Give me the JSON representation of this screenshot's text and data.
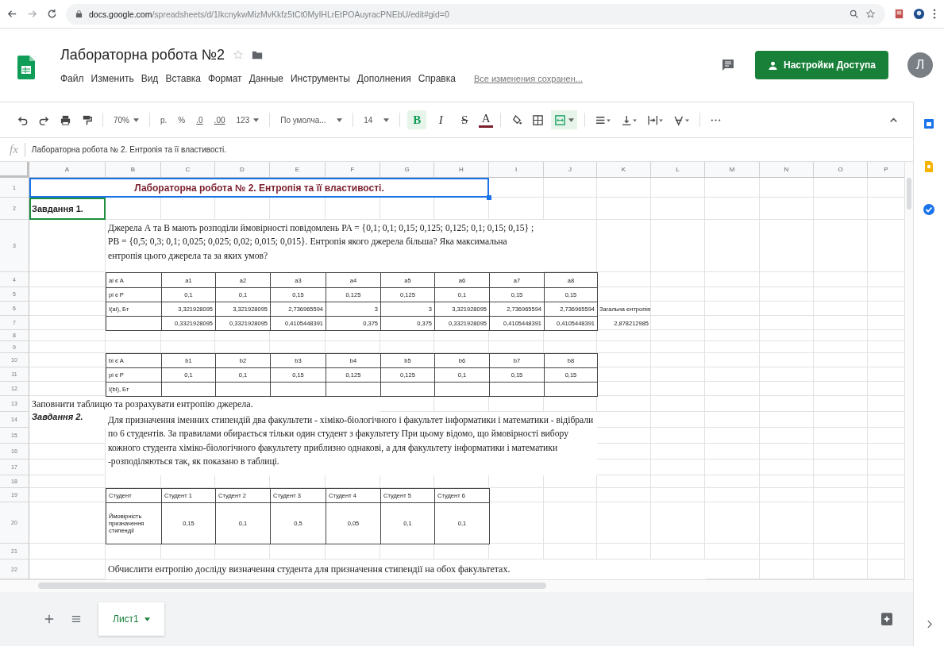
{
  "browser": {
    "url": {
      "host": "docs.google.com",
      "path": "/spreadsheets/d/1lkcnykwMizMvKkfz5tCt0MyIHLrEtPOAuyracPNEbU/edit#gid=0"
    }
  },
  "document": {
    "title": "Лабораторна робота №2",
    "starred": false,
    "save_status": "Все изменения сохранен...",
    "share_button": "Настройки Доступа",
    "avatar": "Л"
  },
  "menu": [
    "Файл",
    "Изменить",
    "Вид",
    "Вставка",
    "Формат",
    "Данные",
    "Инструменты",
    "Дополнения",
    "Справка"
  ],
  "toolbar": {
    "zoom": "70%",
    "currency": "р.",
    "percent": "%",
    "decrease_decimals": ".0",
    "increase_decimals": ".00",
    "more_formats": "123",
    "font": "По умолча...",
    "font_size": "14",
    "bold": {
      "label": "B",
      "selected": true
    },
    "italic": {
      "label": "I",
      "selected": false
    },
    "strikethrough": {
      "label": "S",
      "selected": false
    },
    "text_color": {
      "label": "A",
      "color": "#7b1f2e"
    },
    "merge": {
      "selected": true
    }
  },
  "formula_bar": {
    "label": "fx",
    "value": "Лабораторна робота № 2.  Ентропія та її властивості."
  },
  "sheet": {
    "columns": [
      "A",
      "B",
      "C",
      "D",
      "E",
      "F",
      "G",
      "H",
      "I",
      "J",
      "K",
      "L",
      "M",
      "N",
      "O",
      "P"
    ],
    "rows": [
      "1",
      "2",
      "3",
      "4",
      "5",
      "6",
      "7",
      "8",
      "9",
      "10",
      "11",
      "12",
      "13",
      "14",
      "15",
      "16",
      "17",
      "18",
      "19",
      "20",
      "21",
      "22"
    ],
    "cells": [
      {
        "kind": "title",
        "text": "Лабораторна робота № 2.  Ентропія та її властивості.",
        "selected": true,
        "collaborator_cursor": false
      },
      {
        "kind": "task",
        "text": "Завдання 1.",
        "selected": false,
        "collaborator_cursor": true
      },
      {
        "kind": "prose",
        "text": "Джерела А та В мають розподіли ймовірності повідомлень PA = {0,1; 0,1; 0,15; 0,125; 0,125; 0,1; 0,15; 0,15} ; PB = {0,5; 0,3; 0,1; 0,025; 0,025; 0,02; 0,015; 0,015}. Ентропія якого джерела більша? Яка максимальна ентропія цього джерела та за яких умов?",
        "selected": false,
        "collaborator_cursor": false
      },
      {
        "kind": "small",
        "text": "Загальна ентропія",
        "selected": false,
        "collaborator_cursor": false
      },
      {
        "kind": "small-number",
        "text": "2,878212985",
        "selected": false,
        "collaborator_cursor": false
      },
      {
        "kind": "sentence",
        "text": "Заповнити таблицю та розрахувати ентропію джерела.",
        "selected": false,
        "collaborator_cursor": false
      },
      {
        "kind": "task-italic",
        "text": "Завдання 2.",
        "selected": false,
        "collaborator_cursor": false
      },
      {
        "kind": "prose",
        "text": "Для призначення іменних стипендій два факультети - хіміко-біологічного і факультет інформатики і математики - відібрали по 6 студентів. За правилами обирається тільки один студент з факультету При цьому відомо, що ймовірності вибору кожного студента хіміко-біологічного факультету приблизно однакові, а для факультету інформатики і математики -розподіляються так, як показано в таблиці.",
        "selected": false,
        "collaborator_cursor": false
      },
      {
        "kind": "sentence",
        "text": "Обчислити ентропію досліду визначення студента для призначення стипендії на обох факультетах.",
        "selected": false,
        "collaborator_cursor": false
      }
    ],
    "tables": [
      {
        "rows": [
          {
            "kind": "header",
            "cells": [
              "ai є A",
              "a1",
              "a2",
              "a3",
              "a4",
              "a5",
              "a6",
              "a7",
              "a8"
            ]
          },
          {
            "kind": "header",
            "cells": [
              "pi є P",
              "0,1",
              "0,1",
              "0,15",
              "0,125",
              "0,125",
              "0,1",
              "0,15",
              "0,15"
            ]
          },
          {
            "kind": "numbers",
            "cells": [
              "I(ai), Бт",
              "3,321928095",
              "3,321928095",
              "2,736965594",
              "3",
              "3",
              "3,321928095",
              "2,736965594",
              "2,736965594"
            ]
          },
          {
            "kind": "numbers",
            "cells": [
              null,
              "0,3321928095",
              "0,3321928095",
              "0,4105448391",
              "0,375",
              "0,375",
              "0,3321928095",
              "0,4105448391",
              "0,4105448391"
            ]
          }
        ]
      },
      {
        "rows": [
          {
            "kind": "header",
            "cells": [
              "bi є A",
              "b1",
              "b2",
              "b3",
              "b4",
              "b5",
              "b6",
              "b7",
              "b8"
            ]
          },
          {
            "kind": "header",
            "cells": [
              "pi є P",
              "0,1",
              "0,1",
              "0,15",
              "0,125",
              "0,125",
              "0,1",
              "0,15",
              "0,15"
            ]
          },
          {
            "kind": "numbers",
            "cells": [
              "I(bi), Бт",
              null,
              null,
              null,
              null,
              null,
              null,
              null,
              null
            ]
          }
        ]
      },
      {
        "rows": [
          {
            "kind": "labels",
            "cells": [
              "Студент",
              "Студент 1",
              "Студент 2",
              "Студент 3",
              "Студент 4",
              "Студент 5",
              "Студент 6"
            ]
          },
          {
            "kind": "header",
            "cells": [
              "Ймовірність призначення стипендії",
              "0,15",
              "0,1",
              "0,5",
              "0,05",
              "0,1",
              "0,1"
            ]
          }
        ]
      }
    ]
  },
  "sheet_tabs": [
    {
      "label": "Лист1",
      "selected": true
    }
  ]
}
